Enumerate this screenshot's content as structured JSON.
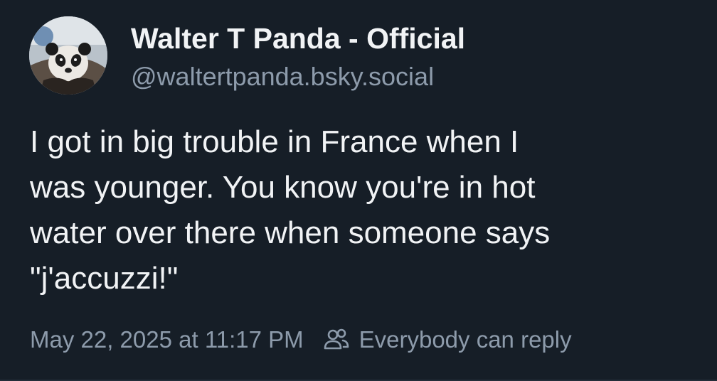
{
  "author": {
    "display_name": "Walter T Panda - Official",
    "handle": "@waltertpanda.bsky.social",
    "avatar_icon": "panda-avatar"
  },
  "post": {
    "text": "I got in big trouble in France when I\nwas younger. You know you're in hot\nwater over there when someone says\n\"j'accuzzi!\""
  },
  "meta": {
    "timestamp": "May 22, 2025 at 11:17 PM",
    "reply_setting": "Everybody can reply",
    "reply_icon": "people-icon"
  },
  "colors": {
    "background": "#161e27",
    "primary_text": "#f1f3f5",
    "secondary_text": "#8d9bab"
  }
}
